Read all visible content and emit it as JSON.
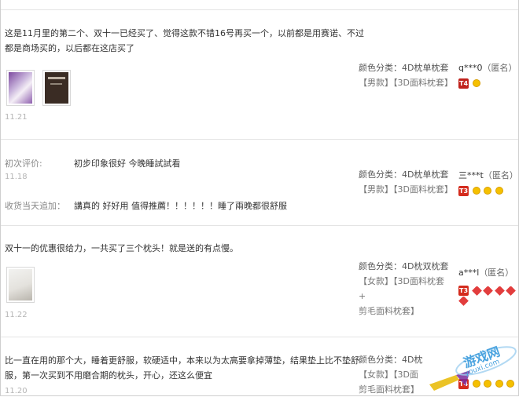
{
  "reviews": [
    {
      "text_line1": "这是11月里的第二个、双十一已经买了、觉得这款不错16号再买一个，以前都是用赛诺、不过",
      "text_line2": "都是商场买的，以后都在这店买了",
      "date": "11.21",
      "sku_label": "颜色分类：4D枕单枕套",
      "sku_line2": "【男款】【3D面料枕套】",
      "user": "q***0",
      "anon": "（匿名）",
      "level": "T4"
    },
    {
      "initial_label": "初次评价:",
      "initial_text": "初步印象很好 今晚睡試試看",
      "date": "11.18",
      "followup_label": "收货当天追加：",
      "followup_text": "講真的 好好用 值得推薦！！！！！！睡了兩晚都很舒服",
      "sku_label": "颜色分类：4D枕单枕套",
      "sku_line2": "【男款】【3D面料枕套】",
      "user": "三***t",
      "anon": "（匿名）",
      "level": "T3"
    },
    {
      "text_line1": "双十一的优惠很给力，一共买了三个枕头！就是送的有点慢。",
      "date": "11.22",
      "sku_label": "颜色分类：4D枕双枕套",
      "sku_line2": "【女款】【3D面料枕套+",
      "sku_line3": "剪毛面料枕套】",
      "user": "a***l",
      "anon": "（匿名）",
      "level": "T3"
    },
    {
      "text_line1": "比一直在用的那个大，睡着更舒服，软硬适中，本来以为太高要拿掉薄垫，结果垫上比不垫舒",
      "text_line2": "服，第一次买到不用磨合期的枕头，开心，还这么便宜",
      "date": "11.20",
      "sku_label": "颜色分类：4D枕",
      "sku_line2": "【女款】【3D面",
      "sku_line3": "剪毛面料枕套】",
      "level": "T4"
    }
  ],
  "watermark": {
    "text": "游戏网",
    "sub": "youxi.com"
  },
  "colors": {
    "level_badge": "#c0221c",
    "gold_dot": "#f5c000",
    "heart": "#e23d3d"
  }
}
